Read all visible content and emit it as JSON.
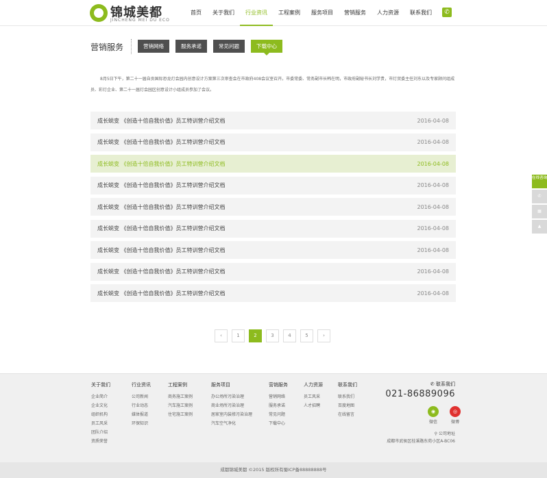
{
  "header": {
    "logo_name": "锦城美都",
    "logo_sub": "JINCHENG MEI DU ECO",
    "nav": [
      "首页",
      "关于我们",
      "行业资讯",
      "工程案例",
      "服务项目",
      "营销服务",
      "人力资源",
      "联系我们"
    ],
    "nav_active": 2,
    "phone_icon": "phone-icon"
  },
  "section": {
    "title": "营销服务",
    "tabs": [
      "营销网络",
      "服务承诺",
      "常见问题",
      "下载中心"
    ],
    "active_tab": 3
  },
  "intro": "8月5日下午，第二十一届自贡国际恐龙灯会园内创意设计方案第三次审查会在市政府408会议室召开。市委常委、常务副市长韩在明，市政府副秘书长刘学贵，市灯贸委主任刘东以及专家顾问组成员、彩灯企业、第二十一届灯会园区创意设计小组成员参加了会议。",
  "list": {
    "rows": [
      {
        "title": "成长蜕变 《创造十倍自我价值》员工特训营介绍文档",
        "date": "2016-04-08"
      },
      {
        "title": "成长蜕变 《创造十倍自我价值》员工特训营介绍文档",
        "date": "2016-04-08"
      },
      {
        "title": "成长蜕变 《创造十倍自我价值》员工特训营介绍文档",
        "date": "2016-04-08"
      },
      {
        "title": "成长蜕变 《创造十倍自我价值》员工特训营介绍文档",
        "date": "2016-04-08"
      },
      {
        "title": "成长蜕变 《创造十倍自我价值》员工特训营介绍文档",
        "date": "2016-04-08"
      },
      {
        "title": "成长蜕变 《创造十倍自我价值》员工特训营介绍文档",
        "date": "2016-04-08"
      },
      {
        "title": "成长蜕变 《创造十倍自我价值》员工特训营介绍文档",
        "date": "2016-04-08"
      },
      {
        "title": "成长蜕变 《创造十倍自我价值》员工特训营介绍文档",
        "date": "2016-04-08"
      },
      {
        "title": "成长蜕变 《创造十倍自我价值》员工特训营介绍文档",
        "date": "2016-04-08"
      }
    ],
    "highlight_index": 2
  },
  "pager": {
    "prev": "‹",
    "pages": [
      "1",
      "2",
      "3",
      "4",
      "5"
    ],
    "current": "2",
    "next": "›"
  },
  "sidebar": {
    "consult": "在线咨询",
    "phone_icon": "phone-icon",
    "qr_icon": "qrcode-icon",
    "top_icon": "back-to-top-icon"
  },
  "footer": {
    "columns": [
      {
        "head": "关于我们",
        "links": [
          "企业简介",
          "企业文化",
          "组织机构",
          "员工风采",
          "团队介绍",
          "资质荣誉"
        ]
      },
      {
        "head": "行业资讯",
        "links": [
          "公司新闻",
          "行业动态",
          "媒体报道",
          "环保知识"
        ]
      },
      {
        "head": "工程案例",
        "links": [
          "商务施工案例",
          "汽车施工案例",
          "住宅施工案例"
        ]
      },
      {
        "head": "服务项目",
        "links": [
          "办公场所污染治理",
          "商业场所污染治理",
          "居家室内装修污染治理",
          "汽车空气净化"
        ]
      },
      {
        "head": "营销服务",
        "links": [
          "营销网络",
          "服务承诺",
          "常见问题",
          "下载中心"
        ]
      },
      {
        "head": "人力资源",
        "links": [
          "员工风采",
          "人才招聘"
        ]
      },
      {
        "head": "联系我们",
        "links": [
          "联系我们",
          "百度地图",
          "在线留言"
        ]
      }
    ],
    "contact_label": "联系我们",
    "contact_phone": "021-86889096",
    "wechat": "微信",
    "weibo": "微博",
    "address_label": "公司地址",
    "address": "成都市武侯区桂溪路东苑小区A-BC06",
    "copyright": "成都锦城美都   ©2015 版权所有蜀ICP备88888888号"
  },
  "colors": {
    "accent": "#8dbb1e",
    "dark_tab": "#4f4f4f",
    "highlight_row": "#e7efd2"
  }
}
